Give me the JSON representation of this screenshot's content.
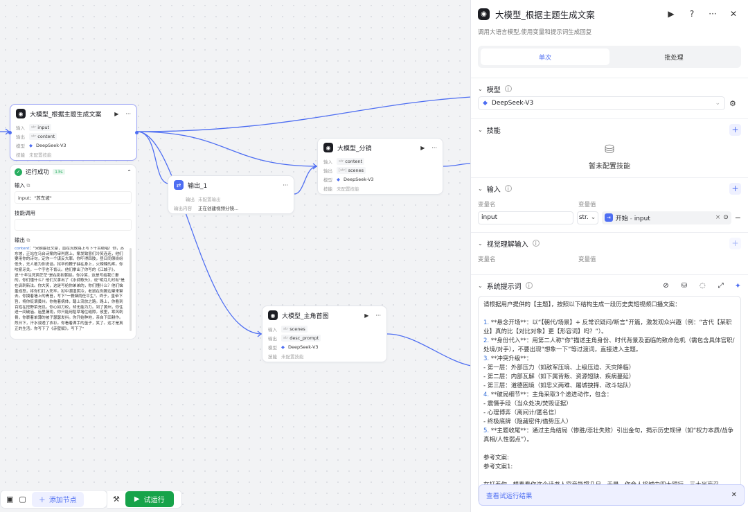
{
  "canvas": {
    "nodes": {
      "llm_main": {
        "title": "大模型_根据主题生成文案",
        "play": "▶",
        "more": "···",
        "input_label": "输入",
        "input_tag_type": "str",
        "input_tag": "input",
        "output_label": "输出",
        "output_tag_type": "str",
        "output_tag": "content",
        "model_label": "模型",
        "model": "DeepSeek-V3",
        "skill_label": "技能",
        "skill": "未配置技能"
      },
      "output1": {
        "title": "输出_1",
        "more": "···",
        "output_label": "输出",
        "output_value": "未配置输出",
        "content_label": "输出内容",
        "content_value": "正在创建视频分镜..."
      },
      "llm_split": {
        "title": "大模型_分镜",
        "play": "▶",
        "more": "···",
        "input_label": "输入",
        "input_tag_type": "str",
        "input_tag": "content",
        "output_label": "输出",
        "output_tag_type": "[str]",
        "output_tag": "scenes",
        "model_label": "模型",
        "model": "DeepSeek-V3",
        "skill_label": "技能",
        "skill": "未配置技能"
      },
      "llm_img": {
        "title": "大模型_主角首图",
        "play": "▶",
        "more": "···",
        "input_label": "输入",
        "input_tag_type": "str",
        "input_tag": "scenes",
        "output_label": "输出",
        "output_tag_type": "str",
        "output_tag": "desc_prompt",
        "model_label": "模型",
        "model": "DeepSeek-V3",
        "skill_label": "技能",
        "skill": "未配置技能"
      }
    },
    "run_result": {
      "status": "运行成功",
      "time": "13s",
      "input_label": "输入",
      "input_value": "input：\"苏东坡\"",
      "skill_label": "技能调用",
      "output_label": "输出",
      "output_key": "content",
      "output_value": "：\"宋朝最狂文豪，竟在流放路上写下千古绝唱！你，苏东坡，正站在乌台诗案的审判席上，案发致意们冷笑连连，他们要用你的诗句，定你一个谋反大罪。你吓得四肢，昼日同僚纷纷低头，无人敢为你说话。狱卒的鞭子抽在身上，火辣辣的疼。你咬紧牙关，一个字也不肯认。他们拿出了你写的《江城子》，说\"十年生死两茫茫\"是在影射朝廷。你冷笑，这是写给我亡妻的，你们懂什么？他们又拿出了《水调歌头》，说\"明月几时有\"是在讽刺新法。你大笑，这是写给你弟弟的，你们懂什么？他们恼羞成怒，将你们打入死牢。狱中潮湿阴冷，老鼠在你脚边窜来窜去。你摸着墙上的青苔，写下\"一蓑烟雨任平生\"。终于，皇帝下旨，将你贬谪黄州。你拖着病体，踏上流放之路。路上，你看到百姓在挖野菜充饥。你心如刀绞，却无能为力。到了黄州，你住进一间破庙。庙里漏雨，你只能用稻草堵住缝隙。夜里，寒风刺骨，你裹着单薄的被子瑟瑟发抖。你开始种地，亲自下田耕作。烈日下，汗水浸透了衣衫。你看着满手的茧子，笑了。这才是真正的生活。你写下了《赤壁赋》，写下了\""
    },
    "toolbar": {
      "add_node": "添加节点",
      "run": "试运行"
    }
  },
  "panel": {
    "title": "大模型_根据主题生成文案",
    "description": "调用大语言模型,使用变量和提示词生成回复",
    "tabs": [
      "单次",
      "批处理"
    ],
    "model_section": {
      "title": "模型",
      "value": "DeepSeek-V3"
    },
    "skills_section": {
      "title": "技能",
      "empty": "暂未配置技能"
    },
    "input_section": {
      "title": "输入",
      "col_name": "变量名",
      "col_value": "变量值",
      "var_name": "input",
      "var_type": "str.",
      "ref_node": "开始",
      "ref_sep": " - ",
      "ref_var": "input"
    },
    "vision_section": {
      "title": "视觉理解输入",
      "col_name": "变量名",
      "col_value": "变量值"
    },
    "prompt_section": {
      "title": "系统提示词",
      "lines": [
        "请根据用户提供的【主题】，按照以下结构生成一段历史类短视频口播文案：",
        "",
        "1. **悬念开场**：以“【朝代/场景】+ 反常识疑问/断言”开篇，激发观众兴趣（例：“古代【某职业】真的比【对比对象】更【形容词】吗？”）。",
        "2. **身份代入**：用第二人称“你”描述主角身份、时代背景及面临的致命危机（需包含具体官职/处境/对手），不要出现“想象一下”等过渡词，直接进入主题。",
        "3. **冲突升级**：",
        "- 第一层：外部压力（如敌军压境、上级压迫、天灾降临）",
        "- 第二层：内部瓦解（如下属背叛、资源短缺、疾病蔓延）",
        "- 第三层：道德困境（如忠义两难、屠城抉择、政斗站队）",
        "4. **破局细节**：主角采取3个递进动作，包含：",
        "- 震慑手段（当众处决/焚毁证据）",
        "- 心理博弈（离间计/匿名信）",
        "- 终极底牌（隐藏密件/借势压人）",
        "5. **主题收尾**：通过主角结局（惨胜/悲壮失败）引出金句，揭示历史规律（如“权力本质/战争真相/人性弱点”）。",
        "",
        "参考文案:",
        "参考文案1:",
        "",
        "在打着你，想看看你这个读书人究竟能撑几日。于是，你命人将城中四大银行、三大米商召"
      ]
    },
    "toast": "查看试运行结果"
  }
}
